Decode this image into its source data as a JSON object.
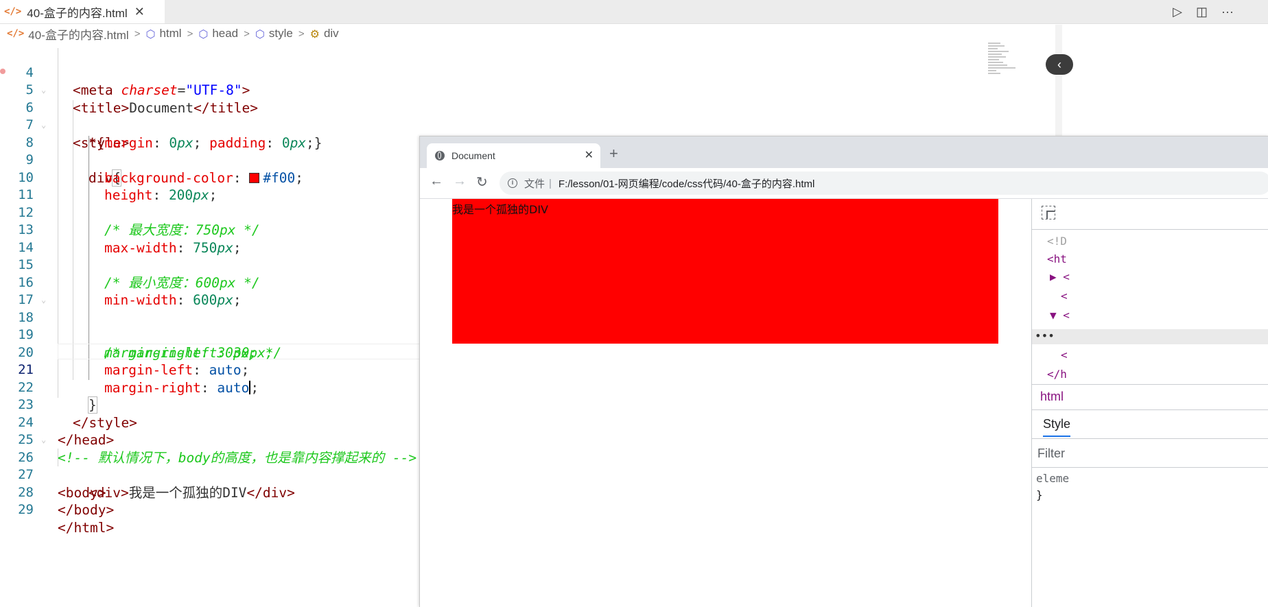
{
  "editor_tab": {
    "icon": "</>",
    "label": "40-盒子的内容.html",
    "close": "✕"
  },
  "tab_actions": {
    "run": "▷",
    "split": "◫",
    "more": "···"
  },
  "breadcrumb": {
    "file_icon": "</>",
    "items": [
      "40-盒子的内容.html",
      "html",
      "head",
      "style",
      "div"
    ],
    "separator": ">"
  },
  "code_lines": [
    {
      "n": "4"
    },
    {
      "n": "5"
    },
    {
      "n": "6"
    },
    {
      "n": "7"
    },
    {
      "n": "8"
    },
    {
      "n": "9"
    },
    {
      "n": "10"
    },
    {
      "n": "11"
    },
    {
      "n": "12"
    },
    {
      "n": "13"
    },
    {
      "n": "14"
    },
    {
      "n": "15"
    },
    {
      "n": "16"
    },
    {
      "n": "17"
    },
    {
      "n": "18"
    },
    {
      "n": "19"
    },
    {
      "n": "20"
    },
    {
      "n": "21"
    },
    {
      "n": "22"
    },
    {
      "n": "23"
    },
    {
      "n": "24"
    },
    {
      "n": "25"
    },
    {
      "n": "26"
    },
    {
      "n": "27"
    },
    {
      "n": "28"
    },
    {
      "n": "29"
    }
  ],
  "code": {
    "l4": {
      "t1": "<meta ",
      "t2": "charset",
      "t3": "=",
      "t4": "\"UTF-8\"",
      "t5": ">"
    },
    "l5": {
      "t1": "<title>",
      "t2": "Document",
      "t3": "</title>"
    },
    "l6": {
      "t1": "<style>"
    },
    "l7": {
      "t1": "*{",
      "t2": "margin",
      "t3": ": ",
      "t4": "0",
      "t5": "px",
      "t6": "; ",
      "t7": "padding",
      "t8": ": ",
      "t9": "0",
      "t10": "px",
      "t11": ";}"
    },
    "l8": {
      "t1": "div",
      "t2": "{"
    },
    "l9": {
      "t1": "background-color",
      "t2": ": ",
      "t3": "#f00",
      "t4": ";"
    },
    "l10": {
      "t1": "height",
      "t2": ": ",
      "t3": "200",
      "t4": "px",
      "t5": ";"
    },
    "l12": {
      "t1": "/* 最大宽度：750px */"
    },
    "l13": {
      "t1": "max-width",
      "t2": ": ",
      "t3": "750",
      "t4": "px",
      "t5": ";"
    },
    "l15": {
      "t1": "/* 最小宽度：600px */"
    },
    "l16": {
      "t1": "min-width",
      "t2": ": ",
      "t3": "600",
      "t4": "px",
      "t5": ";"
    },
    "l18": {
      "t1": "/* margin-left: 30px;"
    },
    "l19": {
      "t1": "margin-right: 30px; */"
    },
    "l20": {
      "t1": "margin-left",
      "t2": ": ",
      "t3": "auto",
      "t4": ";"
    },
    "l21": {
      "t1": "margin-right",
      "t2": ": ",
      "t3": "auto",
      "t4": ";"
    },
    "l22": {
      "t1": "}"
    },
    "l23": {
      "t1": "</style>"
    },
    "l24": {
      "t1": "</head>"
    },
    "l25": {
      "t1": "<!-- 默认情况下，body的高度，也是靠内容撑起来的 -->"
    },
    "l26": {
      "t1": "<body>"
    },
    "l27": {
      "t1": "<div>",
      "t2": "我是一个孤独的DIV",
      "t3": "</div>"
    },
    "l28": {
      "t1": "</body>"
    },
    "l29": {
      "t1": "</html>"
    }
  },
  "browser": {
    "tab_title": "Document",
    "tab_close": "✕",
    "new_tab": "+",
    "nav": {
      "back": "←",
      "forward": "→",
      "reload": "↻"
    },
    "scheme_label": "文件",
    "url": "F:/lesson/01-网页编程/code/css代码/40-盒子的内容.html",
    "page_text": "我是一个孤独的DIV",
    "div_color": "#ff0000"
  },
  "devtools": {
    "rows": [
      "<!D",
      "<ht",
      "▶ <",
      "<",
      "▼ <",
      "•••",
      "<",
      "</h"
    ],
    "crumb": "html",
    "styles_tab": "Style",
    "filter_placeholder": "Filter",
    "rule_selector": "eleme",
    "rule_close": "}"
  }
}
